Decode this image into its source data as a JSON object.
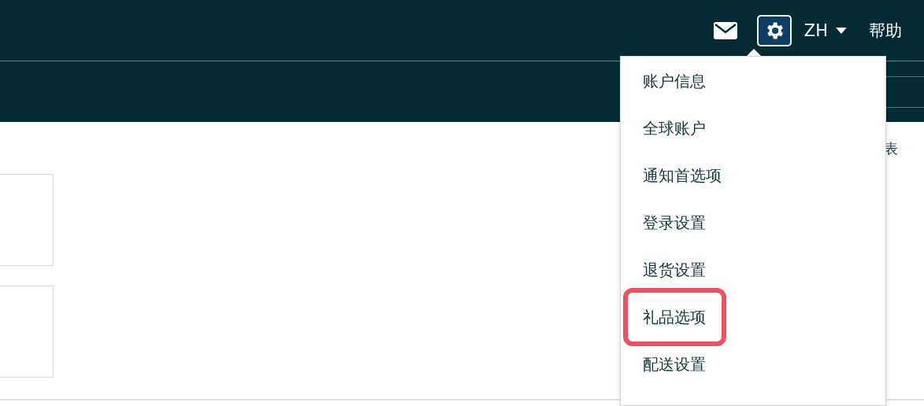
{
  "top_bar": {
    "language": "ZH",
    "help": "帮助",
    "settings_active": true
  },
  "page": {
    "side_text": "表"
  },
  "settings_menu": {
    "items": [
      {
        "label": "账户信息",
        "highlighted": false
      },
      {
        "label": "全球账户",
        "highlighted": false
      },
      {
        "label": "通知首选项",
        "highlighted": false
      },
      {
        "label": "登录设置",
        "highlighted": false
      },
      {
        "label": "退货设置",
        "highlighted": false
      },
      {
        "label": "礼品选项",
        "highlighted": true
      },
      {
        "label": "配送设置",
        "highlighted": false
      }
    ]
  }
}
